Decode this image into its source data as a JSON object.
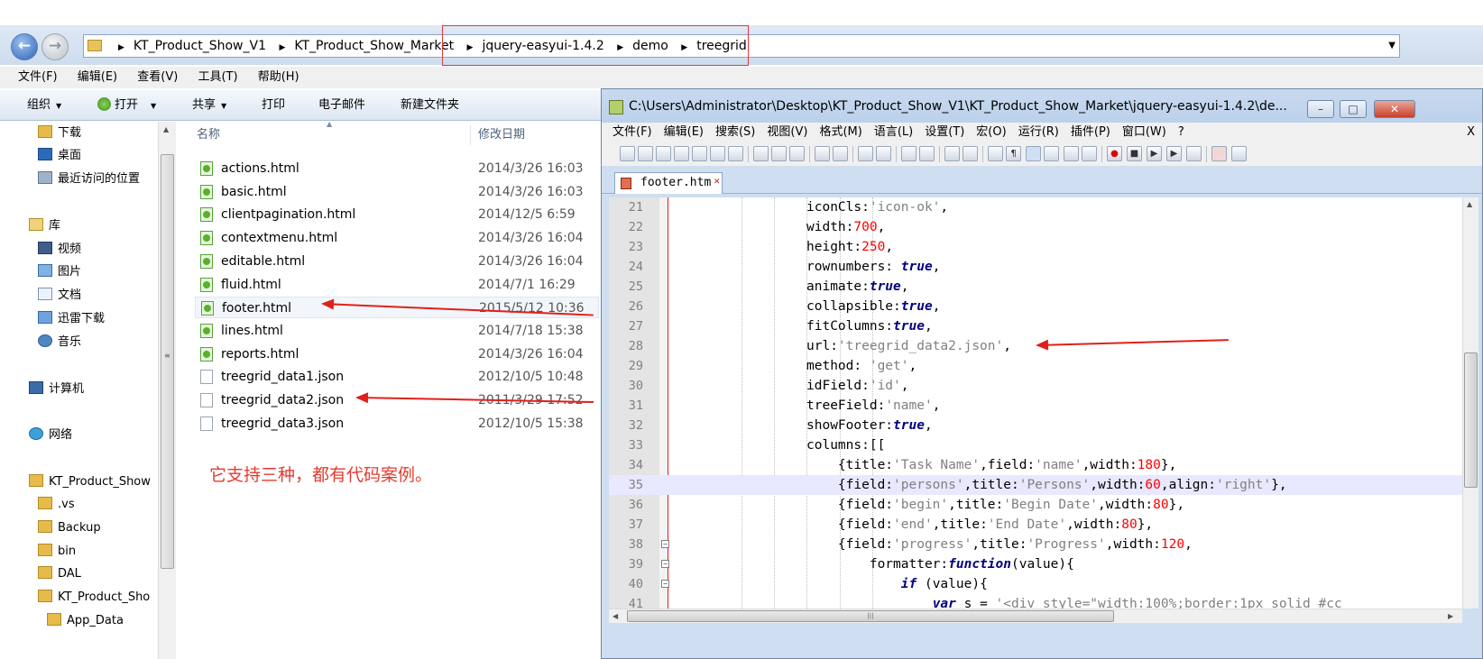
{
  "explorer": {
    "breadcrumb": [
      "KT_Product_Show_V1",
      "KT_Product_Show_Market",
      "jquery-easyui-1.4.2",
      "demo",
      "treegrid"
    ],
    "menu": [
      "文件(F)",
      "编辑(E)",
      "查看(V)",
      "工具(T)",
      "帮助(H)"
    ],
    "toolbar": {
      "organize": "组织",
      "open": "打开",
      "share": "共享",
      "print": "打印",
      "email": "电子邮件",
      "new_folder": "新建文件夹"
    },
    "nav": {
      "favorites": [
        "下载",
        "桌面",
        "最近访问的位置"
      ],
      "library": "库",
      "libraries": [
        "视频",
        "图片",
        "文档",
        "迅雷下载",
        "音乐"
      ],
      "computer": "计算机",
      "network": "网络",
      "folders": [
        "KT_Product_Show",
        ".vs",
        "Backup",
        "bin",
        "DAL",
        "KT_Product_Sho",
        "App_Data"
      ]
    },
    "columns": {
      "name": "名称",
      "date": "修改日期"
    },
    "files": [
      {
        "name": "actions.html",
        "date": "2014/3/26 16:03",
        "type": "html"
      },
      {
        "name": "basic.html",
        "date": "2014/3/26 16:03",
        "type": "html"
      },
      {
        "name": "clientpagination.html",
        "date": "2014/12/5 6:59",
        "type": "html"
      },
      {
        "name": "contextmenu.html",
        "date": "2014/3/26 16:04",
        "type": "html"
      },
      {
        "name": "editable.html",
        "date": "2014/3/26 16:04",
        "type": "html"
      },
      {
        "name": "fluid.html",
        "date": "2014/7/1 16:29",
        "type": "html"
      },
      {
        "name": "footer.html",
        "date": "2015/5/12 10:36",
        "type": "html"
      },
      {
        "name": "lines.html",
        "date": "2014/7/18 15:38",
        "type": "html"
      },
      {
        "name": "reports.html",
        "date": "2014/3/26 16:04",
        "type": "html"
      },
      {
        "name": "treegrid_data1.json",
        "date": "2012/10/5 10:48",
        "type": "json"
      },
      {
        "name": "treegrid_data2.json",
        "date": "2011/3/29 17:52",
        "type": "json"
      },
      {
        "name": "treegrid_data3.json",
        "date": "2012/10/5 15:38",
        "type": "json"
      }
    ],
    "annotation": "它支持三种，都有代码案例。"
  },
  "npp": {
    "title": "C:\\Users\\Administrator\\Desktop\\KT_Product_Show_V1\\KT_Product_Show_Market\\jquery-easyui-1.4.2\\de...",
    "window_buttons": {
      "minimize": "–",
      "maximize": "□",
      "close": "✕"
    },
    "menu": [
      "文件(F)",
      "编辑(E)",
      "搜索(S)",
      "视图(V)",
      "格式(M)",
      "语言(L)",
      "设置(T)",
      "宏(O)",
      "运行(R)",
      "插件(P)",
      "窗口(W)",
      "?"
    ],
    "menu_close": "X",
    "tab": "footer.htm",
    "tab_close": "✕",
    "lines": [
      21,
      22,
      23,
      24,
      25,
      26,
      27,
      28,
      29,
      30,
      31,
      32,
      33,
      34,
      35,
      36,
      37,
      38,
      39,
      40,
      41
    ],
    "current_line": 35
  },
  "colors": {
    "accent": "#e0201a",
    "selection": "#e8e8ff"
  }
}
